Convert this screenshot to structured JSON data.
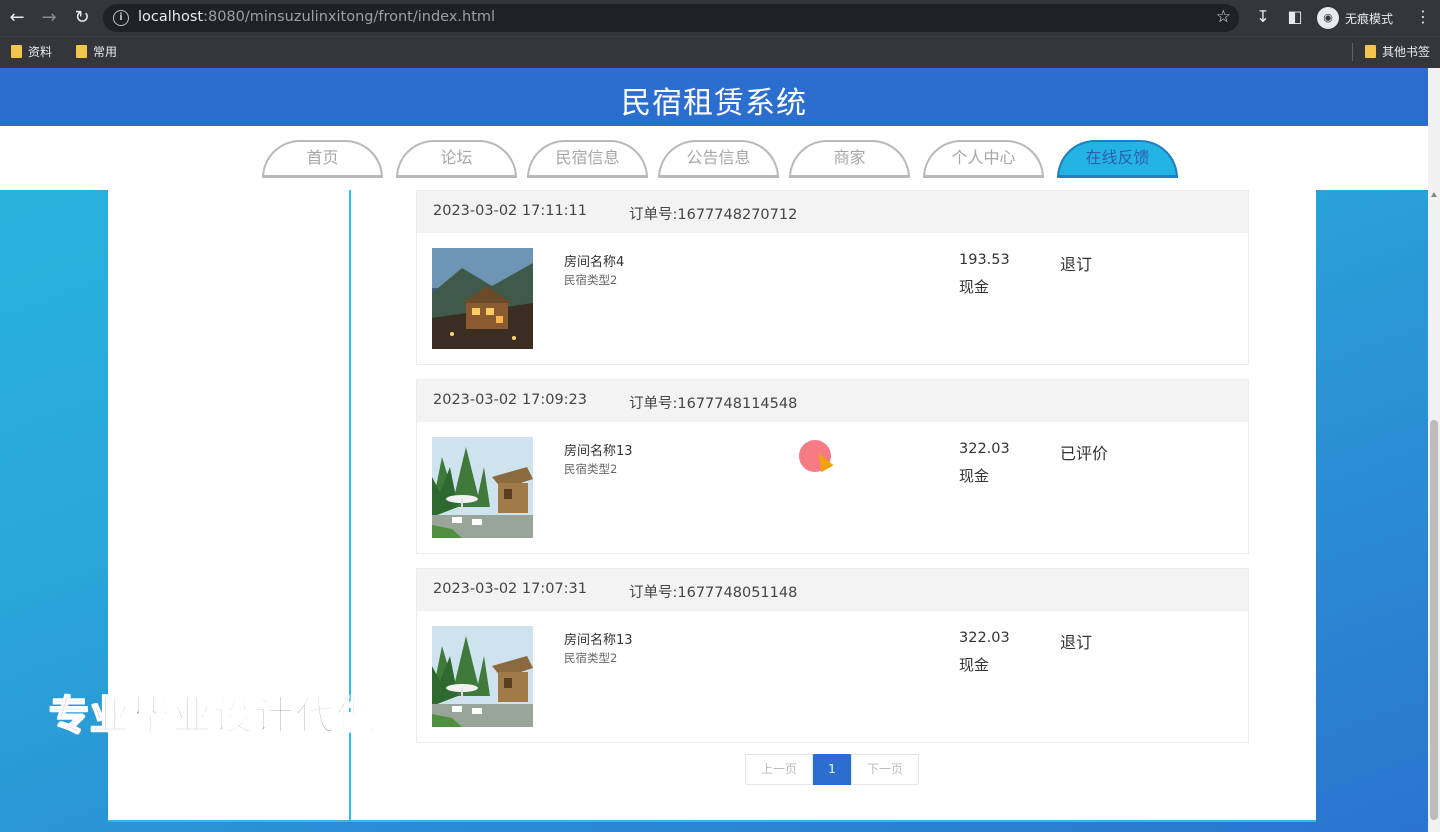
{
  "browser": {
    "url_host": "localhost",
    "url_rest": ":8080/minsuzulinxitong/front/index.html",
    "incognito_label": "无痕模式",
    "bookmarks": [
      "资料",
      "常用"
    ],
    "other_bookmarks": "其他书签"
  },
  "site": {
    "title": "民宿租赁系统",
    "nav": [
      {
        "label": "首页",
        "active": false
      },
      {
        "label": "论坛",
        "active": false
      },
      {
        "label": "民宿信息",
        "active": false
      },
      {
        "label": "公告信息",
        "active": false
      },
      {
        "label": "商家",
        "active": false
      },
      {
        "label": "个人中心",
        "active": false
      },
      {
        "label": "在线反馈",
        "active": true
      }
    ]
  },
  "orders": [
    {
      "time": "2023-03-02 17:11:11",
      "order_no": "订单号:1677748270712",
      "room_name": "房间名称4",
      "room_type": "民宿类型2",
      "price": "193.53",
      "payment": "现金",
      "status": "退订",
      "image": "mountain-lodge"
    },
    {
      "time": "2023-03-02 17:09:23",
      "order_no": "订单号:1677748114548",
      "room_name": "房间名称13",
      "room_type": "民宿类型2",
      "price": "322.03",
      "payment": "现金",
      "status": "已评价",
      "image": "garden-terrace"
    },
    {
      "time": "2023-03-02 17:07:31",
      "order_no": "订单号:1677748051148",
      "room_name": "房间名称13",
      "room_type": "民宿类型2",
      "price": "322.03",
      "payment": "现金",
      "status": "退订",
      "image": "garden-terrace"
    }
  ],
  "pagination": {
    "prev": "上一页",
    "current": "1",
    "next": "下一页"
  },
  "watermark": "专业毕业设计代做",
  "colors": {
    "header": "#2c6ed0",
    "active_tab": "#24b4e2",
    "accent_line": "#2fbfe2"
  }
}
